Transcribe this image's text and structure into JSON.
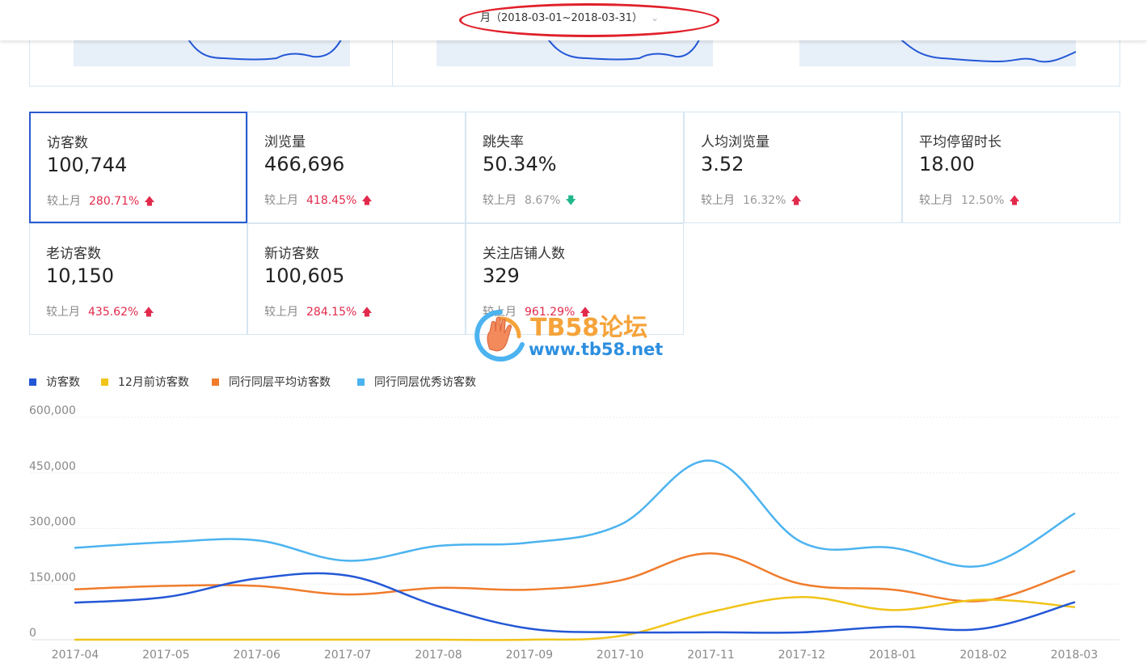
{
  "date_filter": {
    "label": "月（2018-03-01~2018-03-31）",
    "chevron": "chevron-down-icon"
  },
  "metrics": [
    {
      "label": "访客数",
      "value": "100,744",
      "compare_label": "较上月",
      "pct": "280.71%",
      "trend": "up",
      "active": true
    },
    {
      "label": "浏览量",
      "value": "466,696",
      "compare_label": "较上月",
      "pct": "418.45%",
      "trend": "up",
      "active": false
    },
    {
      "label": "跳失率",
      "value": "50.34%",
      "compare_label": "较上月",
      "pct": "8.67%",
      "trend": "down",
      "active": false
    },
    {
      "label": "人均浏览量",
      "value": "3.52",
      "compare_label": "较上月",
      "pct": "16.32%",
      "trend": "up",
      "active": false
    },
    {
      "label": "平均停留时长",
      "value": "18.00",
      "compare_label": "较上月",
      "pct": "12.50%",
      "trend": "up",
      "active": false
    },
    {
      "label": "老访客数",
      "value": "10,150",
      "compare_label": "较上月",
      "pct": "435.62%",
      "trend": "up",
      "active": false
    },
    {
      "label": "新访客数",
      "value": "100,605",
      "compare_label": "较上月",
      "pct": "284.15%",
      "trend": "up",
      "active": false
    },
    {
      "label": "关注店铺人数",
      "value": "329",
      "compare_label": "较上月",
      "pct": "961.29%",
      "trend": "up",
      "active": false
    }
  ],
  "watermark": {
    "title": "TB58论坛",
    "url": "www.tb58.net"
  },
  "colors": {
    "visitors": "#2357d6",
    "prev12": "#f0c419",
    "peer_avg": "#f07c2c",
    "peer_top": "#4cb3f0",
    "up": "#e22a4c",
    "down": "#1fb78b",
    "active_border": "#2a5bd0"
  },
  "chart_data": {
    "type": "line",
    "categories": [
      "2017-04",
      "2017-05",
      "2017-06",
      "2017-07",
      "2017-08",
      "2017-09",
      "2017-10",
      "2017-11",
      "2017-12",
      "2018-01",
      "2018-02",
      "2018-03"
    ],
    "ylim": [
      0,
      600000
    ],
    "yticks": [
      0,
      150000,
      300000,
      450000,
      600000
    ],
    "ytick_labels": [
      "0",
      "150,000",
      "300,000",
      "450,000",
      "600,000"
    ],
    "grid": true,
    "legend_position": "top-left",
    "series": [
      {
        "name": "访客数",
        "color": "#2357d6",
        "values": [
          100000,
          115000,
          165000,
          173000,
          90000,
          30000,
          20000,
          20000,
          20000,
          35000,
          30000,
          100744
        ]
      },
      {
        "name": "12月前访客数",
        "color": "#f0c419",
        "values": [
          0,
          0,
          0,
          0,
          0,
          0,
          10000,
          75000,
          115000,
          80000,
          108000,
          88000
        ]
      },
      {
        "name": "同行同层平均访客数",
        "color": "#f07c2c",
        "values": [
          136000,
          145000,
          145000,
          122000,
          140000,
          135000,
          160000,
          233000,
          150000,
          135000,
          105000,
          185000
        ]
      },
      {
        "name": "同行同层优秀访客数",
        "color": "#4cb3f0",
        "values": [
          248000,
          263000,
          268000,
          213000,
          253000,
          262000,
          310000,
          483000,
          263000,
          248000,
          200000,
          340000
        ]
      }
    ]
  }
}
